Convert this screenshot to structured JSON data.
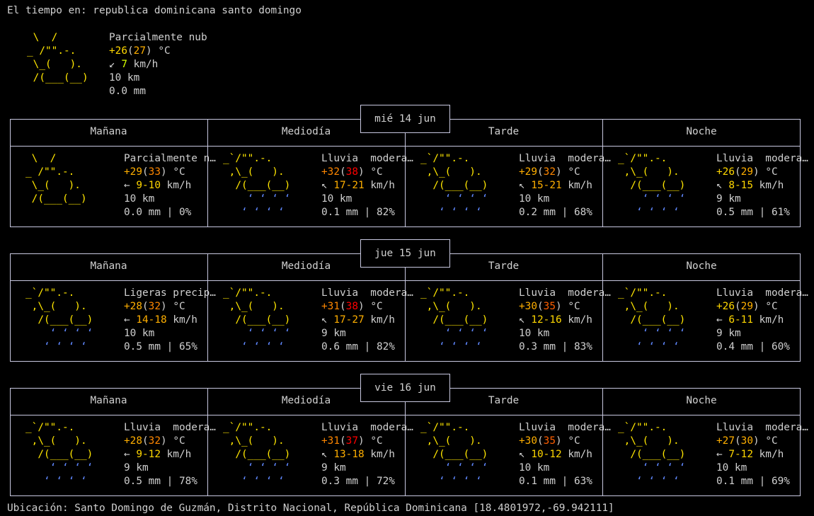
{
  "header": {
    "title": "El tiempo en: republica dominicana santo domingo"
  },
  "current": {
    "art": [
      " \\  /      ",
      "_ /\"\".-.    ",
      " \\_(   ).   ",
      " /(___(__)  ",
      "            "
    ],
    "condition": "Parcialmente nublado",
    "temp": "+26",
    "feels": "27",
    "temp_unit": "°C",
    "wind_arrow": "↙",
    "wind": "7",
    "wind_unit": "km/h",
    "visibility": "10 km",
    "precip": "0.0 mm"
  },
  "days": [
    {
      "date": "mié 14 jun",
      "periods": [
        {
          "name": "Mañana",
          "art": [
            " \\  /      ",
            "_ /\"\".-.    ",
            " \\_(   ).   ",
            " /(___(__)  ",
            "            "
          ],
          "rain": false,
          "condition": "Parcialmente n…",
          "temp": "+29",
          "feels": "33",
          "temp_unit": "°C",
          "wind_arrow": "←",
          "wind": "9-10",
          "wind_unit": "km/h",
          "visibility": "10 km",
          "precip": "0.0 mm | 0%"
        },
        {
          "name": "Mediodía",
          "art": [
            "_`/\"\".-.    ",
            " ,\\_(   ).  ",
            "  /(___(__) ",
            "    ‘ ‘ ‘ ‘ ",
            "   ‘ ‘ ‘ ‘  "
          ],
          "rain": true,
          "condition": "Lluvia  modera…",
          "temp": "+32",
          "feels": "38",
          "temp_unit": "°C",
          "wind_arrow": "↖",
          "wind": "17-21",
          "wind_unit": "km/h",
          "visibility": "10 km",
          "precip": "0.1 mm | 82%"
        },
        {
          "name": "Tarde",
          "art": [
            "_`/\"\".-.    ",
            " ,\\_(   ).  ",
            "  /(___(__) ",
            "    ‘ ‘ ‘ ‘ ",
            "   ‘ ‘ ‘ ‘  "
          ],
          "rain": true,
          "condition": "Lluvia  modera…",
          "temp": "+29",
          "feels": "32",
          "temp_unit": "°C",
          "wind_arrow": "↖",
          "wind": "15-21",
          "wind_unit": "km/h",
          "visibility": "10 km",
          "precip": "0.2 mm | 68%"
        },
        {
          "name": "Noche",
          "art": [
            "_`/\"\".-.    ",
            " ,\\_(   ).  ",
            "  /(___(__) ",
            "    ‘ ‘ ‘ ‘ ",
            "   ‘ ‘ ‘ ‘  "
          ],
          "rain": true,
          "condition": "Lluvia  modera…",
          "temp": "+26",
          "feels": "29",
          "temp_unit": "°C",
          "wind_arrow": "↖",
          "wind": "8-15",
          "wind_unit": "km/h",
          "visibility": "9 km",
          "precip": "0.5 mm | 61%"
        }
      ]
    },
    {
      "date": "jue 15 jun",
      "periods": [
        {
          "name": "Mañana",
          "art": [
            "_`/\"\".-.    ",
            " ,\\_(   ).  ",
            "  /(___(__) ",
            "    ‘ ‘ ‘ ‘ ",
            "   ‘ ‘ ‘ ‘  "
          ],
          "rain": true,
          "condition": "Ligeras precip…",
          "temp": "+28",
          "feels": "32",
          "temp_unit": "°C",
          "wind_arrow": "←",
          "wind": "14-18",
          "wind_unit": "km/h",
          "visibility": "10 km",
          "precip": "0.5 mm | 65%"
        },
        {
          "name": "Mediodía",
          "art": [
            "_`/\"\".-.    ",
            " ,\\_(   ).  ",
            "  /(___(__) ",
            "    ‘ ‘ ‘ ‘ ",
            "   ‘ ‘ ‘ ‘  "
          ],
          "rain": true,
          "condition": "Lluvia  modera…",
          "temp": "+31",
          "feels": "38",
          "temp_unit": "°C",
          "wind_arrow": "↖",
          "wind": "17-27",
          "wind_unit": "km/h",
          "visibility": "9 km",
          "precip": "0.6 mm | 82%"
        },
        {
          "name": "Tarde",
          "art": [
            "_`/\"\".-.    ",
            " ,\\_(   ).  ",
            "  /(___(__) ",
            "    ‘ ‘ ‘ ‘ ",
            "   ‘ ‘ ‘ ‘  "
          ],
          "rain": true,
          "condition": "Lluvia  modera…",
          "temp": "+30",
          "feels": "35",
          "temp_unit": "°C",
          "wind_arrow": "↖",
          "wind": "12-16",
          "wind_unit": "km/h",
          "visibility": "10 km",
          "precip": "0.3 mm | 83%"
        },
        {
          "name": "Noche",
          "art": [
            "_`/\"\".-.    ",
            " ,\\_(   ).  ",
            "  /(___(__) ",
            "    ‘ ‘ ‘ ‘ ",
            "   ‘ ‘ ‘ ‘  "
          ],
          "rain": true,
          "condition": "Lluvia  modera…",
          "temp": "+26",
          "feels": "29",
          "temp_unit": "°C",
          "wind_arrow": "←",
          "wind": "6-11",
          "wind_unit": "km/h",
          "visibility": "9 km",
          "precip": "0.4 mm | 60%"
        }
      ]
    },
    {
      "date": "vie 16 jun",
      "periods": [
        {
          "name": "Mañana",
          "art": [
            "_`/\"\".-.    ",
            " ,\\_(   ).  ",
            "  /(___(__) ",
            "    ‘ ‘ ‘ ‘ ",
            "   ‘ ‘ ‘ ‘  "
          ],
          "rain": true,
          "condition": "Lluvia  modera…",
          "temp": "+28",
          "feels": "32",
          "temp_unit": "°C",
          "wind_arrow": "←",
          "wind": "9-12",
          "wind_unit": "km/h",
          "visibility": "9 km",
          "precip": "0.5 mm | 78%"
        },
        {
          "name": "Mediodía",
          "art": [
            "_`/\"\".-.    ",
            " ,\\_(   ).  ",
            "  /(___(__) ",
            "    ‘ ‘ ‘ ‘ ",
            "   ‘ ‘ ‘ ‘  "
          ],
          "rain": true,
          "condition": "Lluvia  modera…",
          "temp": "+31",
          "feels": "37",
          "temp_unit": "°C",
          "wind_arrow": "↖",
          "wind": "13-18",
          "wind_unit": "km/h",
          "visibility": "9 km",
          "precip": "0.3 mm | 72%"
        },
        {
          "name": "Tarde",
          "art": [
            "_`/\"\".-.    ",
            " ,\\_(   ).  ",
            "  /(___(__) ",
            "    ‘ ‘ ‘ ‘ ",
            "   ‘ ‘ ‘ ‘  "
          ],
          "rain": true,
          "condition": "Lluvia  modera…",
          "temp": "+30",
          "feels": "35",
          "temp_unit": "°C",
          "wind_arrow": "↖",
          "wind": "10-12",
          "wind_unit": "km/h",
          "visibility": "10 km",
          "precip": "0.1 mm | 63%"
        },
        {
          "name": "Noche",
          "art": [
            "_`/\"\".-.    ",
            " ,\\_(   ).  ",
            "  /(___(__) ",
            "    ‘ ‘ ‘ ‘ ",
            "   ‘ ‘ ‘ ‘  "
          ],
          "rain": true,
          "condition": "Lluvia  modera…",
          "temp": "+27",
          "feels": "30",
          "temp_unit": "°C",
          "wind_arrow": "←",
          "wind": "7-12",
          "wind_unit": "km/h",
          "visibility": "10 km",
          "precip": "0.1 mm | 69%"
        }
      ]
    }
  ],
  "footer": {
    "location": "Ubicación: Santo Domingo de Guzmán, Distrito Nacional, República Dominicana [18.4801972,-69.942111]"
  },
  "colors": {
    "background": "#000000",
    "text": "#d0d0d0",
    "border": "#c8c8e0",
    "art": "#ffe600",
    "rain": "#5f87ff"
  }
}
